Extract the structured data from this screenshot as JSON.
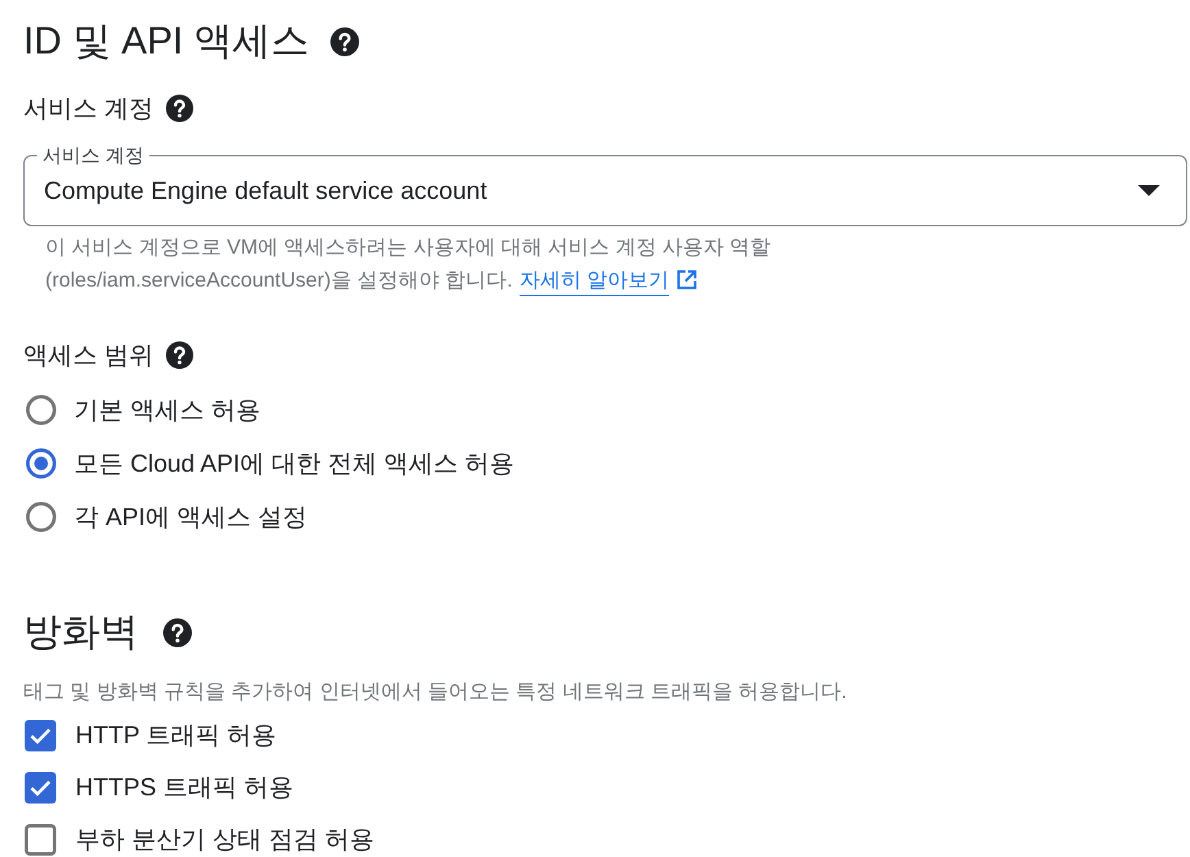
{
  "identity_access": {
    "title": "ID 및 API 액세스",
    "service_account": {
      "label": "서비스 계정",
      "select": {
        "label": "서비스 계정",
        "value": "Compute Engine default service account"
      },
      "helper_text": "이 서비스 계정으로 VM에 액세스하려는 사용자에 대해 서비스 계정 사용자 역할 (roles/iam.serviceAccountUser)을 설정해야 합니다.",
      "link": "자세히 알아보기"
    },
    "access_scope": {
      "label": "액세스 범위",
      "options": [
        {
          "label": "기본 액세스 허용",
          "selected": false
        },
        {
          "label": "모든 Cloud API에 대한 전체 액세스 허용",
          "selected": true
        },
        {
          "label": "각 API에 액세스 설정",
          "selected": false
        }
      ]
    }
  },
  "firewall": {
    "title": "방화벽",
    "description": "태그 및 방화벽 규칙을 추가하여 인터넷에서 들어오는 특정 네트워크 트래픽을 허용합니다.",
    "options": [
      {
        "label": "HTTP 트래픽 허용",
        "checked": true
      },
      {
        "label": "HTTPS 트래픽 허용",
        "checked": true
      },
      {
        "label": "부하 분산기 상태 점검 허용",
        "checked": false
      }
    ]
  }
}
